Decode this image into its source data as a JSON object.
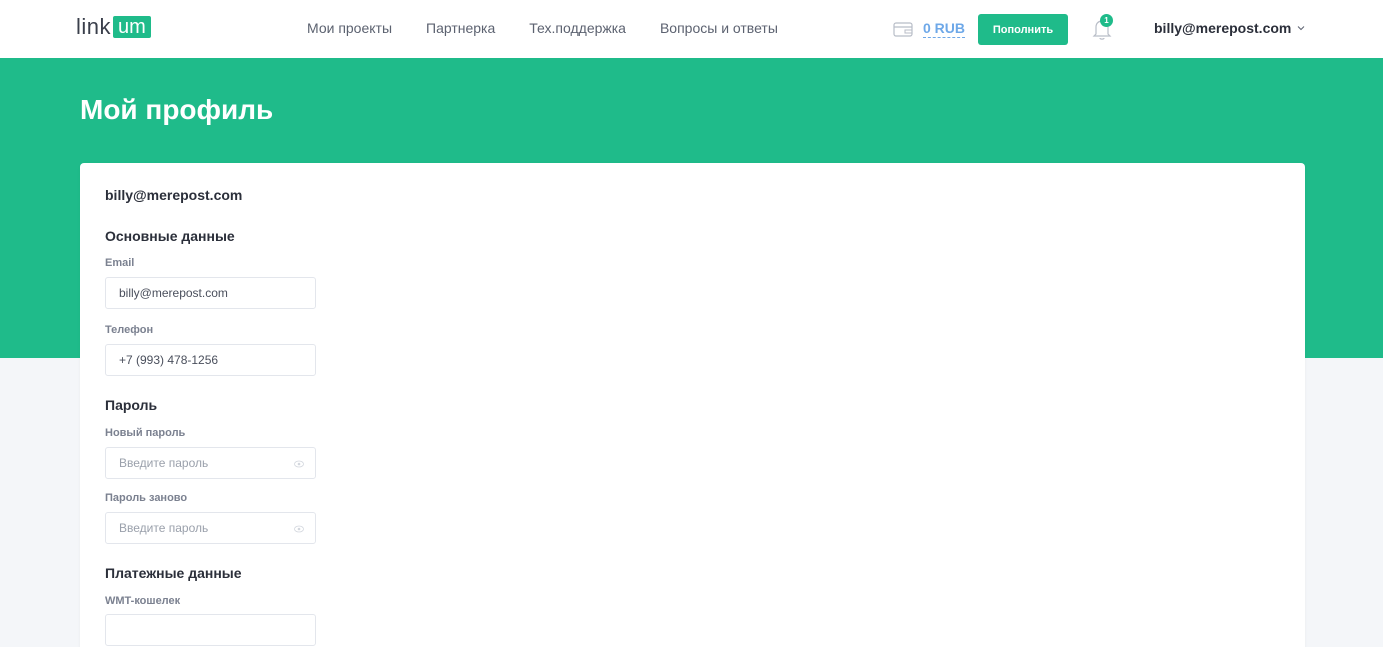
{
  "header": {
    "logo_text": "link",
    "logo_box": "um",
    "nav": [
      "Мои проекты",
      "Партнерка",
      "Тех.поддержка",
      "Вопросы и ответы"
    ],
    "balance": "0 RUB",
    "topup_label": "Пополнить",
    "notification_count": "1",
    "user_email": "billy@merepost.com"
  },
  "page": {
    "title": "Мой профиль"
  },
  "profile": {
    "email_heading": "billy@merepost.com",
    "basic_section": "Основные данные",
    "email_label": "Email",
    "email_value": "billy@merepost.com",
    "phone_label": "Телефон",
    "phone_value": "+7 (993) 478-1256",
    "password_section": "Пароль",
    "new_password_label": "Новый пароль",
    "new_password_placeholder": "Введите пароль",
    "repeat_password_label": "Пароль заново",
    "repeat_password_placeholder": "Введите пароль",
    "payment_section": "Платежные данные",
    "wmt_label": "WMT-кошелек",
    "wmt_value": ""
  },
  "colors": {
    "accent": "#1fbb8a",
    "link": "#6ea8e8",
    "background": "#f4f6f9"
  },
  "icons": [
    "wallet-icon",
    "bell-icon",
    "chevron-down-icon",
    "eye-icon"
  ]
}
